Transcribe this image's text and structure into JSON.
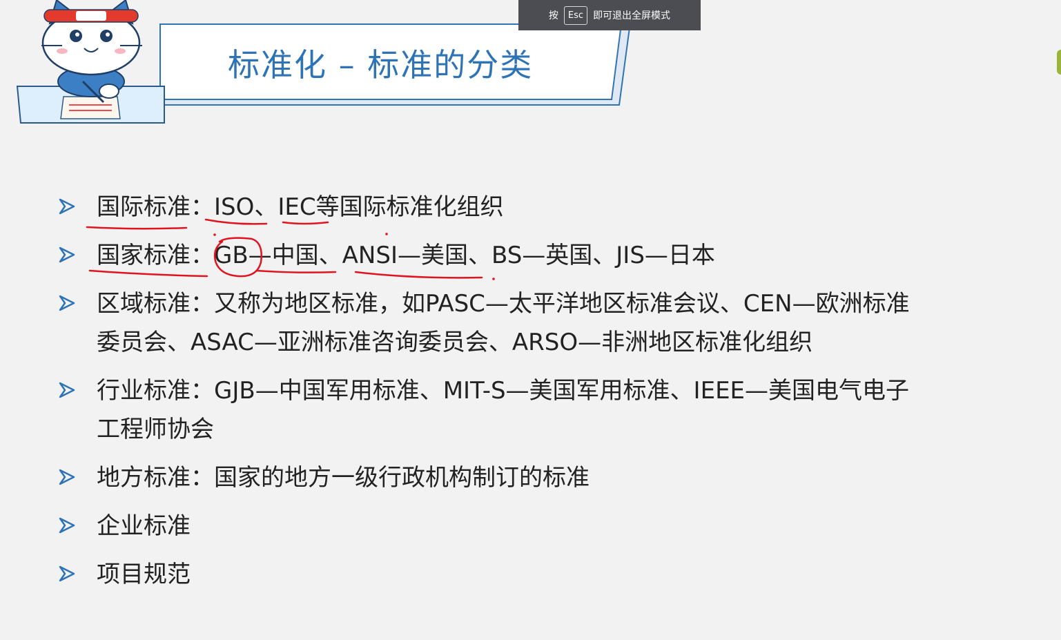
{
  "fullscreen_hint": {
    "prefix": "按",
    "key": "Esc",
    "suffix": "即可退出全屏模式"
  },
  "slide": {
    "title": "标准化 – 标准的分类",
    "colors": {
      "title": "#2e74b5",
      "bullet": "#2e74b5",
      "ink": "#e0141e"
    },
    "bullet_icon": "arrow-right-icon",
    "items": [
      {
        "line1": "国际标准：ISO、IEC等国际标准化组织",
        "line2": ""
      },
      {
        "line1": "国家标准：GB—中国、ANSI—美国、BS—英国、JIS—日本",
        "line2": ""
      },
      {
        "line1": "区域标准：又称为地区标准，如PASC—太平洋地区标准会议、CEN—欧洲标准",
        "line2": "委员会、ASAC—亚洲标准咨询委员会、ARSO—非洲地区标准化组织"
      },
      {
        "line1": "行业标准：GJB—中国军用标准、MIT-S—美国军用标准、IEEE—美国电气电子",
        "line2": "工程师协会"
      },
      {
        "line1": "地方标准：国家的地方一级行政机构制订的标准",
        "line2": ""
      },
      {
        "line1": "企业标准",
        "line2": ""
      },
      {
        "line1": "项目规范",
        "line2": ""
      }
    ]
  }
}
